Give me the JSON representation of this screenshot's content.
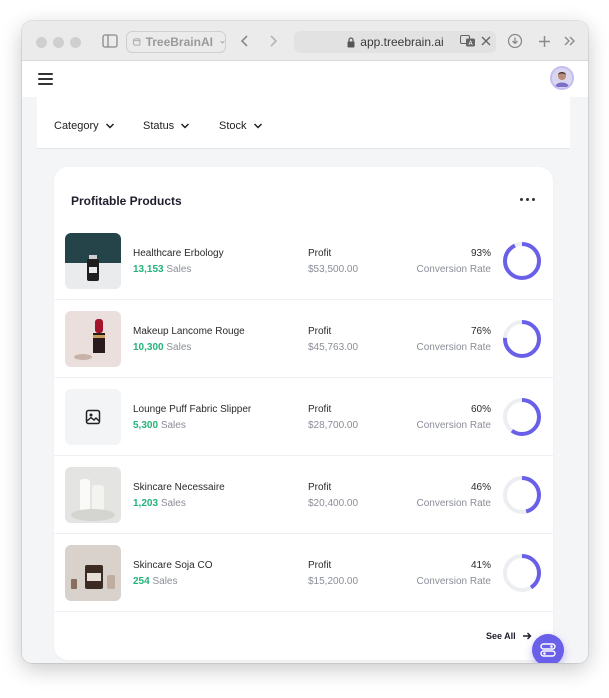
{
  "browser": {
    "tab_label": "TreeBrainAI",
    "url": "app.treebrain.ai"
  },
  "filters": [
    {
      "label": "Category"
    },
    {
      "label": "Status"
    },
    {
      "label": "Stock"
    }
  ],
  "card": {
    "title": "Profitable Products",
    "see_all": "See All",
    "profit_label": "Profit",
    "conversion_label": "Conversion Rate",
    "sales_suffix": "Sales"
  },
  "products": [
    {
      "name": "Healthcare Erbology",
      "sales": "13,153",
      "profit": "$53,500.00",
      "rate_text": "93%",
      "rate": 93,
      "thumb": "bottle"
    },
    {
      "name": "Makeup Lancome Rouge",
      "sales": "10,300",
      "profit": "$45,763.00",
      "rate_text": "76%",
      "rate": 76,
      "thumb": "lipstick"
    },
    {
      "name": "Lounge Puff Fabric Slipper",
      "sales": "5,300",
      "profit": "$28,700.00",
      "rate_text": "60%",
      "rate": 60,
      "thumb": "placeholder-image-icon"
    },
    {
      "name": "Skincare Necessaire",
      "sales": "1,203",
      "profit": "$20,400.00",
      "rate_text": "46%",
      "rate": 46,
      "thumb": "tubes"
    },
    {
      "name": "Skincare Soja CO",
      "sales": "254",
      "profit": "$15,200.00",
      "rate_text": "41%",
      "rate": 41,
      "thumb": "jar"
    }
  ],
  "colors": {
    "accent": "#6a5fe8",
    "sales_green": "#23b27a",
    "ring_track": "#eceef2"
  }
}
